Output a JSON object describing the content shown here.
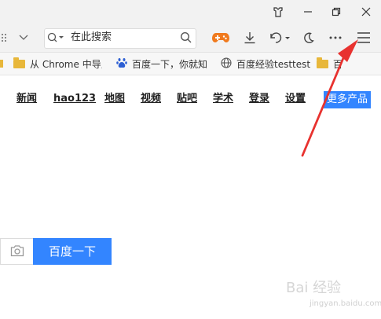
{
  "toolbar": {
    "search_text": "在此搜索"
  },
  "bookmarks": [
    {
      "label": "从 Chrome 中导入",
      "icon": "folder-icon"
    },
    {
      "label": "百度一下，你就知",
      "icon": "baidu-paw-icon"
    },
    {
      "label": "百度经验testtest",
      "icon": "globe-icon"
    },
    {
      "label": "百",
      "icon": "folder-icon"
    }
  ],
  "nav": {
    "links": [
      "新闻",
      "hao123",
      "地图",
      "视频",
      "贴吧",
      "学术",
      "登录",
      "设置"
    ],
    "more_products": "更多产品"
  },
  "search": {
    "button_label": "百度一下"
  },
  "watermark": {
    "text": "Bai 经验",
    "sub": "jingyan.baidu.com"
  },
  "colors": {
    "accent": "#3385ff",
    "annotation_arrow": "#e8322f",
    "game_icon": "#f07a1e"
  }
}
